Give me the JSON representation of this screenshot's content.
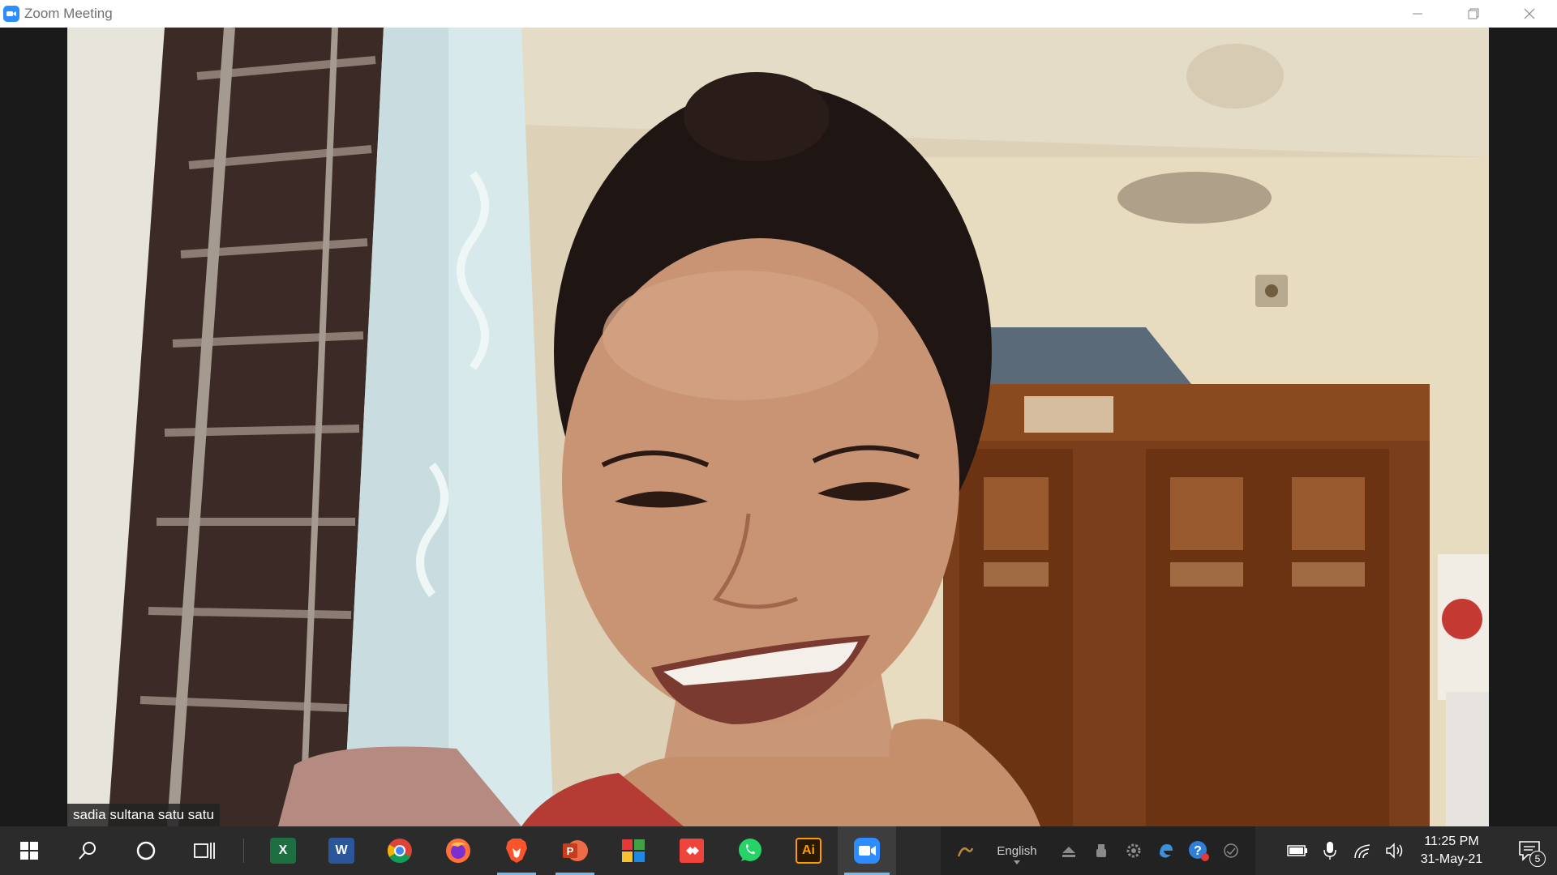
{
  "window": {
    "title": "Zoom Meeting",
    "app_icon": "zoom-icon",
    "controls": [
      "minimize-icon",
      "restore-icon",
      "close-icon"
    ]
  },
  "video": {
    "participant_name": "sadia sultana satu satu"
  },
  "taskbar": {
    "pinned": [
      {
        "name": "start-button",
        "icon": "windows-icon"
      },
      {
        "name": "search-button",
        "icon": "search-icon"
      },
      {
        "name": "cortana-button",
        "icon": "cortana-circle-icon"
      },
      {
        "name": "task-view-button",
        "icon": "task-view-icon"
      },
      {
        "name": "excel-app",
        "icon": "excel-icon",
        "letter": "X",
        "color": "#1d6f42"
      },
      {
        "name": "word-app",
        "icon": "word-icon",
        "letter": "W",
        "color": "#2b579a"
      },
      {
        "name": "chrome-app",
        "icon": "chrome-icon"
      },
      {
        "name": "firefox-app",
        "icon": "firefox-icon"
      },
      {
        "name": "brave-app",
        "icon": "brave-icon",
        "color": "#fb542b"
      },
      {
        "name": "powerpoint-app",
        "icon": "powerpoint-icon",
        "letter": "P",
        "color": "#d24726"
      },
      {
        "name": "colorful-tiles-app",
        "icon": "tiles-icon"
      },
      {
        "name": "anydesk-app",
        "icon": "anydesk-icon",
        "color": "#ef443b"
      },
      {
        "name": "whatsapp-app",
        "icon": "whatsapp-icon",
        "color": "#25d366"
      },
      {
        "name": "illustrator-app",
        "icon": "illustrator-icon",
        "letter": "Ai",
        "color": "#ff9a00"
      },
      {
        "name": "zoom-app",
        "icon": "zoom-icon",
        "color": "#2d8cff"
      }
    ],
    "tray": {
      "language": "English",
      "icons": [
        "pen-icon",
        "eject-icon",
        "usb-icon",
        "settings-icon",
        "edge-icon",
        "help-icon",
        "sync-icon",
        "battery-icon",
        "microphone-icon",
        "wifi-icon",
        "volume-icon"
      ]
    },
    "clock": {
      "time": "11:25 PM",
      "date": "31-May-21"
    },
    "notifications": {
      "icon": "notification-icon",
      "count": "5"
    }
  }
}
